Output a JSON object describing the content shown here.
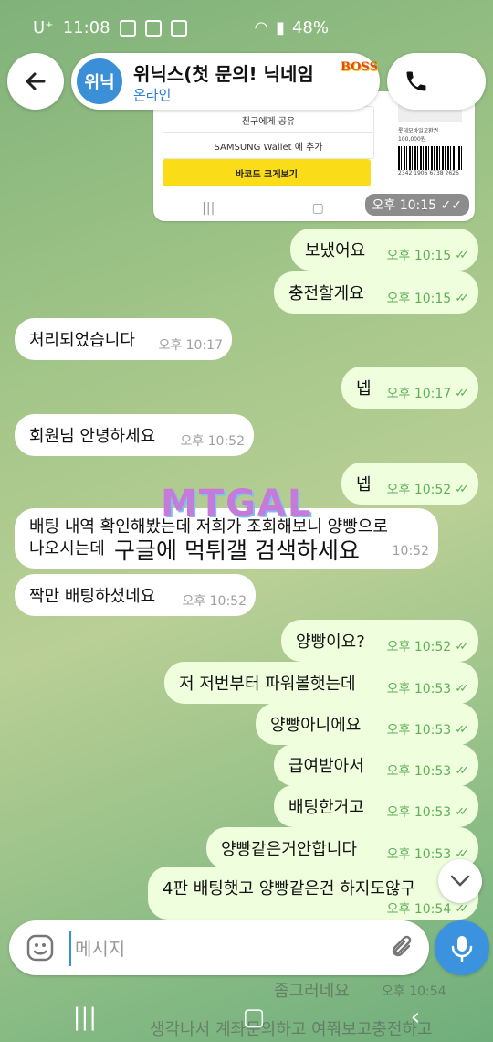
{
  "status_bar": {
    "carrier": "U⁺",
    "time": "11:08",
    "battery": "48%"
  },
  "header": {
    "avatar_text": "위닉",
    "title": "위닉스(첫 문의! 닉네임",
    "status": "온라인",
    "logo_text": "BOSS"
  },
  "photo": {
    "row1": "친구에게 공유",
    "row2": "SAMSUNG Wallet 에 추가",
    "button": "바코드 크게보기",
    "card_title": "롯데모바일교환권 100,000원",
    "card_number": "2342 1906 6738 2626",
    "time": "오후 10:15"
  },
  "messages": [
    {
      "dir": "out",
      "text": "보냈어요",
      "time": "오후 10:15"
    },
    {
      "dir": "out",
      "text": "충전할게요",
      "time": "오후 10:15"
    },
    {
      "dir": "in",
      "text": "처리되었습니다",
      "time": "오후 10:17"
    },
    {
      "dir": "out",
      "text": "넵",
      "time": "오후 10:17"
    },
    {
      "dir": "in",
      "text": "회원님 안녕하세요",
      "time": "오후 10:52"
    },
    {
      "dir": "out",
      "text": "넵",
      "time": "오후 10:52"
    },
    {
      "dir": "in",
      "text": "배팅 내역 확인해봤는데 저희가 조회해보니 양빵으로",
      "text2": "나오시는데",
      "time": "10:52"
    },
    {
      "dir": "in",
      "text": "짝만 배팅하셨네요",
      "time": "오후 10:52"
    },
    {
      "dir": "out",
      "text": "양빵이요?",
      "time": "오후 10:52"
    },
    {
      "dir": "out",
      "text": "저 저번부터 파워볼햇는데",
      "time": "오후 10:53"
    },
    {
      "dir": "out",
      "text": "양빵아니에요",
      "time": "오후 10:53"
    },
    {
      "dir": "out",
      "text": "급여받아서",
      "time": "오후 10:53"
    },
    {
      "dir": "out",
      "text": "배팅한거고",
      "time": "오후 10:53"
    },
    {
      "dir": "out",
      "text": "양빵같은거안합니다",
      "time": "오후 10:53"
    },
    {
      "dir": "out",
      "text": "4판 배팅햇고 양빵같은건 하지도않구",
      "time": "오후 10:54"
    }
  ],
  "faded": {
    "msg1": "좀그러네요",
    "time1": "오후 10:54",
    "msg2": "생각나서 계좌문의하고 여쭤보고충전하고"
  },
  "watermark": {
    "logo": "MTGAL",
    "text": "구글에 먹튀갤 검색하세요"
  },
  "input": {
    "placeholder": "메시지"
  }
}
